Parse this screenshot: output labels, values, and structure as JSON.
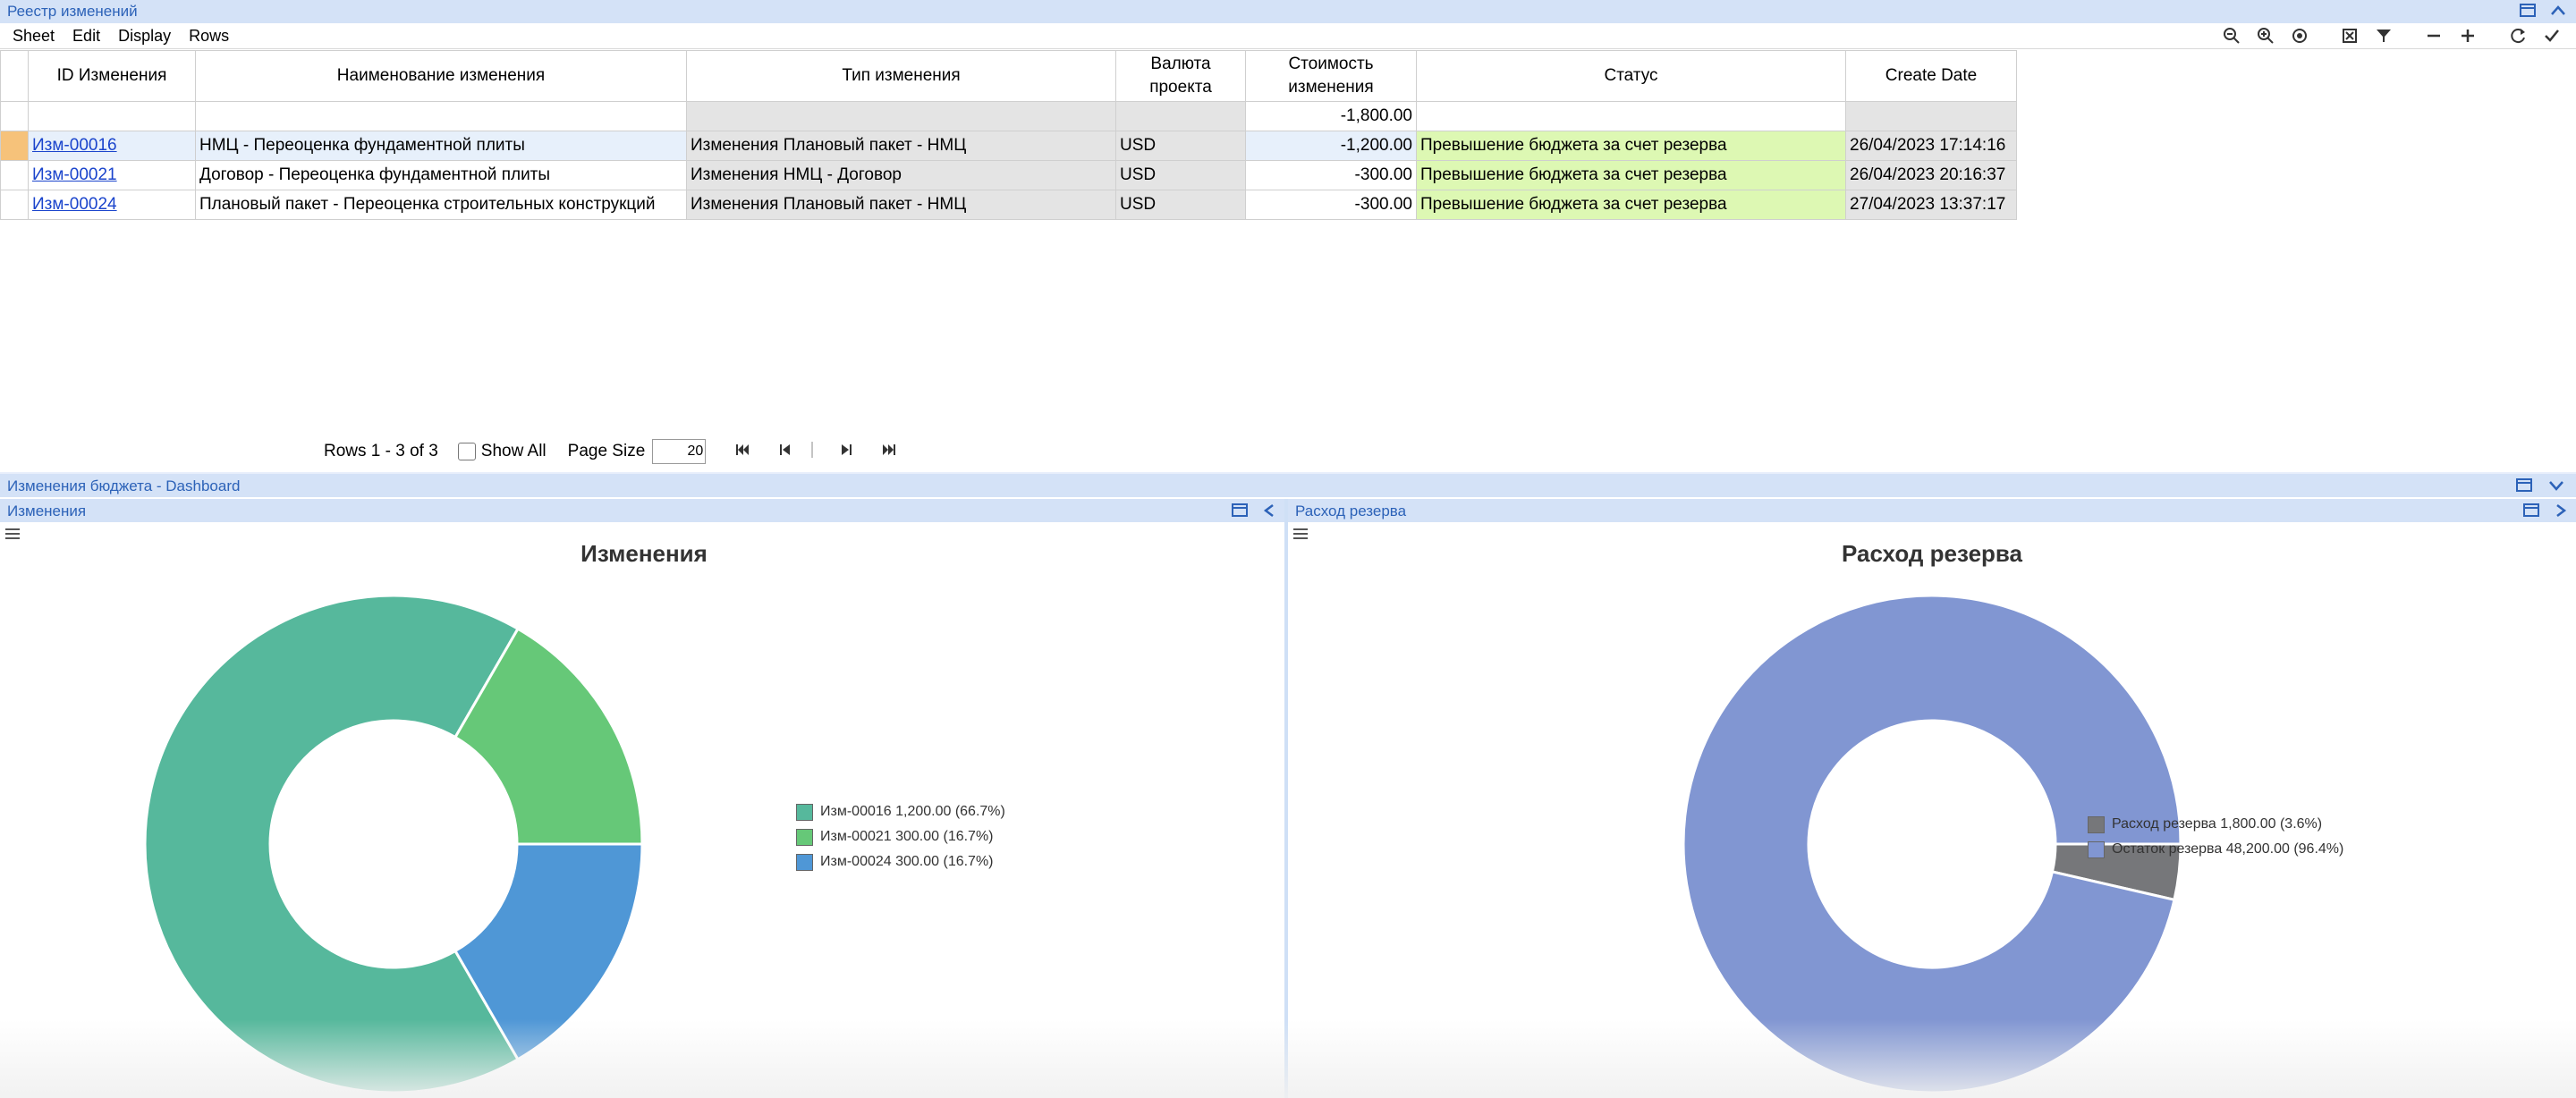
{
  "window": {
    "title": "Реестр изменений"
  },
  "menu": [
    "Sheet",
    "Edit",
    "Display",
    "Rows"
  ],
  "toolbar_icons": [
    "zoom-out-icon",
    "zoom-in-icon",
    "zoom-reset-icon",
    "clear-filter-icon",
    "filter-icon",
    "collapse-icon",
    "expand-icon",
    "refresh-icon",
    "check-icon"
  ],
  "table": {
    "columns": [
      "ID Изменения",
      "Наименование изменения",
      "Тип изменения",
      "Валюта проекта",
      "Стоимость изменения",
      "Статус",
      "Create Date"
    ],
    "total": "-1,800.00",
    "rows": [
      {
        "id": "Изм-00016",
        "name": "НМЦ - Переоценка фундаментной плиты",
        "type": "Изменения Плановый пакет - НМЦ",
        "currency": "USD",
        "cost": "-1,200.00",
        "status": "Превышение бюджета за счет резерва",
        "date": "26/04/2023 17:14:16"
      },
      {
        "id": "Изм-00021",
        "name": "Договор - Переоценка фундаментной плиты",
        "type": "Изменения НМЦ - Договор",
        "currency": "USD",
        "cost": "-300.00",
        "status": "Превышение бюджета за счет резерва",
        "date": "26/04/2023 20:16:37"
      },
      {
        "id": "Изм-00024",
        "name": "Плановый пакет - Переоценка строительных конструкций",
        "type": "Изменения Плановый пакет - НМЦ",
        "currency": "USD",
        "cost": "-300.00",
        "status": "Превышение бюджета за счет резерва",
        "date": "27/04/2023 13:37:17"
      }
    ]
  },
  "pager": {
    "rows_label": "Rows 1 - 3 of 3",
    "show_all": "Show All",
    "page_size_label": "Page Size",
    "page_size": "20"
  },
  "dashboard": {
    "title": "Изменения бюджета - Dashboard",
    "left_panel": "Изменения",
    "right_panel": "Расход резерва"
  },
  "chart_data": [
    {
      "type": "pie",
      "title": "Изменения",
      "donut": true,
      "legend_position": "right",
      "slices": [
        {
          "label": "Изм-00016 1,200.00 (66.7%)",
          "value": 1200,
          "color": "#56b89c"
        },
        {
          "label": "Изм-00021 300.00 (16.7%)",
          "value": 300,
          "color": "#66c878"
        },
        {
          "label": "Изм-00024 300.00 (16.7%)",
          "value": 300,
          "color": "#4f97d6"
        }
      ]
    },
    {
      "type": "pie",
      "title": "Расход резерва",
      "donut": true,
      "legend_position": "right",
      "slices": [
        {
          "label": "Расход резерва 1,800.00 (3.6%)",
          "value": 1800,
          "color": "#76777a"
        },
        {
          "label": "Остаток резерва 48,200.00 (96.4%)",
          "value": 48200,
          "color": "#8196d2"
        }
      ]
    }
  ]
}
